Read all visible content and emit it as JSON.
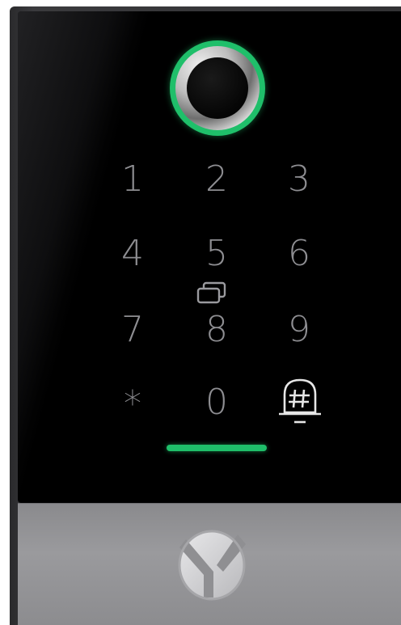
{
  "device": {
    "name": "access-control-keypad",
    "accent_color": "#1fbf6a"
  },
  "sensor": {
    "icon": "fingerprint-sensor-icon",
    "ring_color": "#1fbf6a"
  },
  "keypad": {
    "keys": [
      "1",
      "2",
      "3",
      "4",
      "5",
      "6",
      "7",
      "8",
      "9",
      "*",
      "0"
    ],
    "card_icon": "card-reader-icon",
    "bell_icon": "doorbell-icon",
    "key_color": "#8e8e92"
  },
  "status_led": {
    "color": "#1fbf6a"
  },
  "brand": {
    "logo_icon": "brand-logo-icon"
  }
}
